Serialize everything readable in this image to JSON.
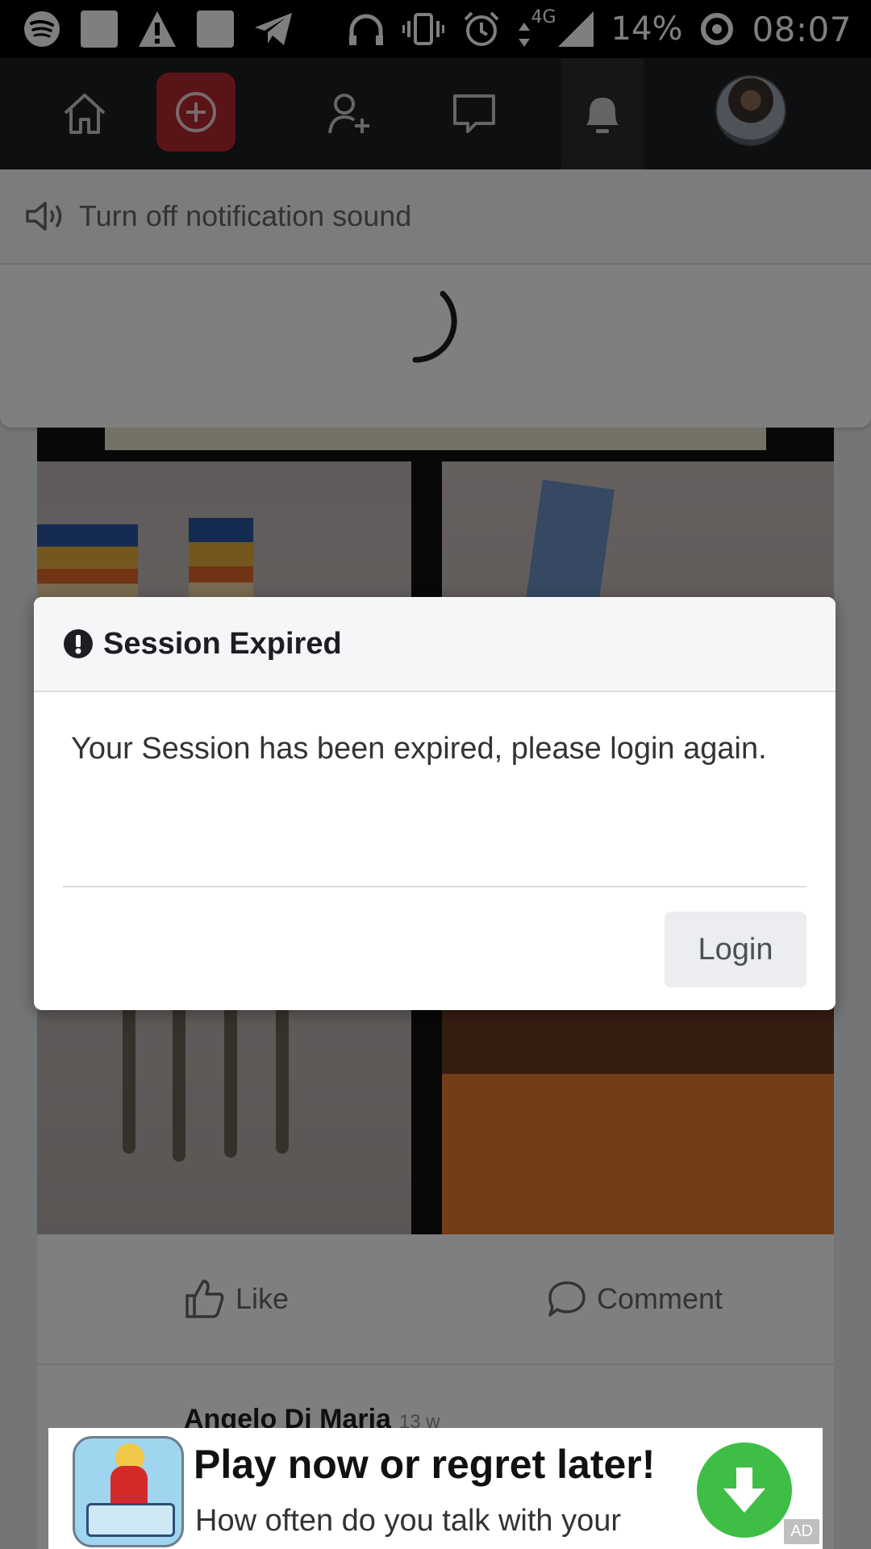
{
  "status_bar": {
    "battery": "14%",
    "time": "08:07",
    "network": "4G",
    "icons": [
      "spotify-icon",
      "notification-square-icon",
      "warning-icon",
      "notification-square-icon",
      "telegram-icon",
      "headset-icon",
      "vibrate-icon",
      "alarm-icon",
      "data-arrows-icon",
      "signal-icon",
      "battery-saver-icon"
    ]
  },
  "nav": {
    "items": [
      "home-icon",
      "add-post-icon",
      "add-friend-icon",
      "messages-icon",
      "notifications-icon",
      "profile-avatar"
    ],
    "active": "notifications",
    "accent": "#b3282e"
  },
  "notifications_panel": {
    "sound_toggle_label": "Turn off notification sound",
    "loading": true
  },
  "post": {
    "author": "Angelo Di Maria",
    "time": "13 w",
    "actions": {
      "like": "Like",
      "comment": "Comment"
    }
  },
  "modal": {
    "title": "Session Expired",
    "message": "Your Session has been expired, please login again.",
    "login_label": "Login"
  },
  "ad": {
    "headline": "Play now or regret later!",
    "subtext": "How often do you talk with your",
    "badge": "AD",
    "accent": "#3fbe46"
  }
}
